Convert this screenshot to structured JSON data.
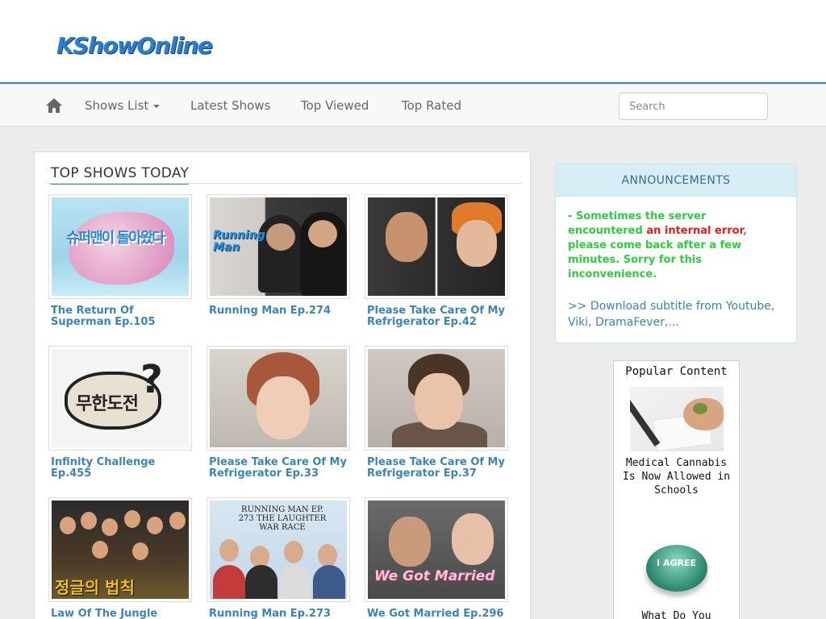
{
  "site": {
    "logo_text": "KShowOnline"
  },
  "nav": {
    "home_icon": "home-icon",
    "items": [
      {
        "label": "Shows List",
        "has_caret": true
      },
      {
        "label": "Latest Shows"
      },
      {
        "label": "Top Viewed"
      },
      {
        "label": "Top Rated"
      }
    ],
    "search_placeholder": "Search"
  },
  "main": {
    "section_title": "TOP SHOWS TODAY",
    "shows": [
      {
        "title": "The Return Of Superman Ep.105",
        "thumb_text": "슈퍼맨이 돌아왔다"
      },
      {
        "title": "Running Man Ep.274",
        "thumb_text": "Running Man"
      },
      {
        "title": "Please Take Care Of My Refrigerator Ep.42"
      },
      {
        "title": "Infinity Challenge Ep.455",
        "thumb_text": "무한도전"
      },
      {
        "title": "Please Take Care Of My Refrigerator Ep.33"
      },
      {
        "title": "Please Take Care Of My Refrigerator Ep.37"
      },
      {
        "title": "Law Of The Jungle",
        "thumb_text": "정글의 법칙"
      },
      {
        "title": "Running Man Ep.273",
        "thumb_text": "RUNNING MAN EP. 273 THE LAUGHTER WAR RACE"
      },
      {
        "title": "We Got Married Ep.296",
        "thumb_text": "We Got Married"
      }
    ]
  },
  "announcements": {
    "title": "ANNOUNCEMENTS",
    "note_prefix": "- Sometimes the server encountered ",
    "note_error": "an internal error",
    "note_suffix": ", please come back after a few minutes. Sorry for this inconvenience.",
    "download_link": ">> Download subtitle from Youtube, Viki, DramaFever,..."
  },
  "popular": {
    "title": "Popular Content",
    "items": [
      {
        "text": "Medical Cannabis Is Now Allowed in Schools"
      },
      {
        "text": "What Do You",
        "thumb_text": "I AGREE"
      }
    ]
  },
  "colors": {
    "accent": "#3a84b8",
    "announce_head_bg": "#d9edf7",
    "note_green": "#2ecc40",
    "error_red": "#e0201a"
  }
}
